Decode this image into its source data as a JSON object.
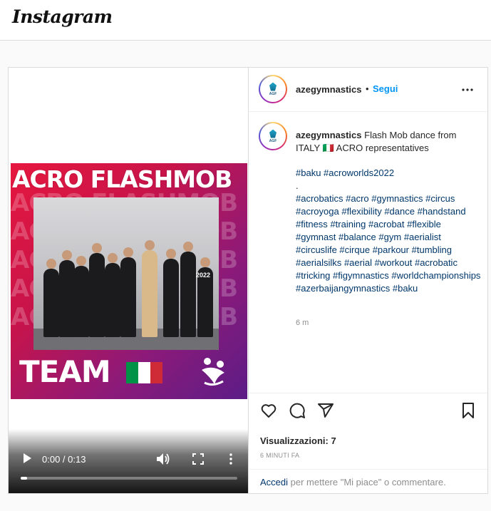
{
  "app": {
    "logo_text": "Instagram"
  },
  "post": {
    "username": "azegymnastics",
    "separator": "•",
    "follow_label": "Segui",
    "avatar_text": "AGF",
    "caption": {
      "username": "azegymnastics",
      "text": "Flash Mob dance from ITALY 🇮🇹 ACRO representatives"
    },
    "hashtags_line1": [
      "#baku",
      "#acroworlds2022"
    ],
    "dot_line": ".",
    "hashtags_block": [
      "#acrobatics",
      "#acro",
      "#gymnastics",
      "#circus",
      "#acroyoga",
      "#flexibility",
      "#dance",
      "#handstand",
      "#fitness",
      "#training",
      "#acrobat",
      "#flexible",
      "#gymnast",
      "#balance",
      "#gym",
      "#aerialist",
      "#circuslife",
      "#cirque",
      "#parkour",
      "#tumbling",
      "#aerialsilks",
      "#aerial",
      "#workout",
      "#acrobatic",
      "#tricking",
      "#figymnastics",
      "#worldchampionships",
      "#azerbaijangymnastics",
      "#baku"
    ],
    "age": "6 m",
    "views_label": "Visualizzazioni: 7",
    "time_ago": "6 MINUTI FA",
    "login_link": "Accedi",
    "login_rest": " per mettere \"Mi piace\" o commentare."
  },
  "video": {
    "artwork_title": "ACRO FLASHMOB",
    "artwork_team": "TEAM",
    "artwork_photo_label": "2022",
    "time": "0:00 / 0:13",
    "progress": 0.03,
    "flag_colors": [
      "#009246",
      "#ffffff",
      "#ce2b37"
    ]
  },
  "icons": {
    "play": "play-icon",
    "volume": "volume-icon",
    "fullscreen": "fullscreen-icon",
    "more": "more-icon",
    "like": "heart-icon",
    "comment": "comment-icon",
    "share": "send-icon",
    "save": "bookmark-icon"
  }
}
